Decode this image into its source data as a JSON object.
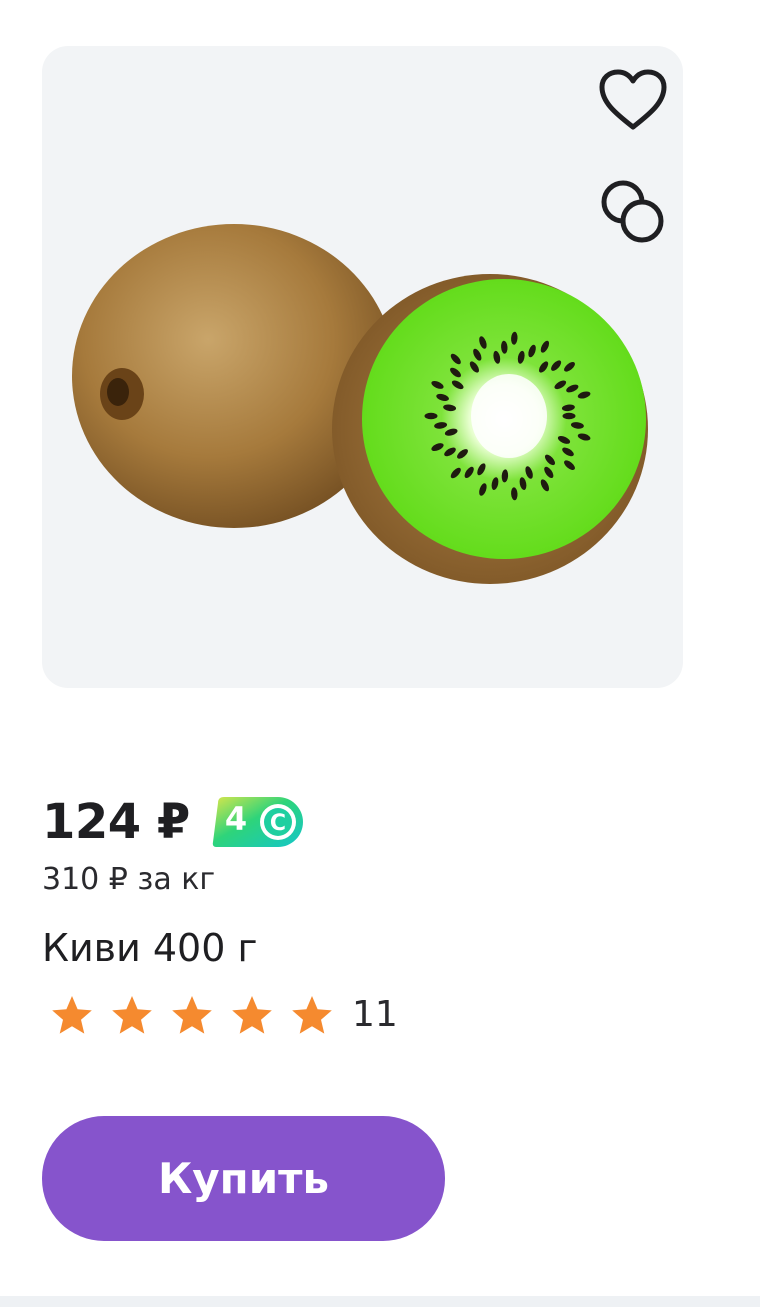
{
  "product": {
    "price": "124 ₽",
    "bonus": "4",
    "unit_price": "310 ₽ за кг",
    "title": "Киви 400 г",
    "rating": 5,
    "rating_max": 5,
    "review_count": "11",
    "buy_label": "Купить"
  },
  "icons": {
    "favorite": "heart-icon",
    "compare": "compare-circles-icon",
    "bonus": "bonus-coin-icon",
    "star": "star-icon"
  },
  "colors": {
    "accent": "#8654cc",
    "star": "#f58a2f",
    "image_bg": "#f2f4f6",
    "badge_green": "#2ed47a",
    "badge_teal": "#14c6c9",
    "badge_yellow": "#d9e64a"
  }
}
